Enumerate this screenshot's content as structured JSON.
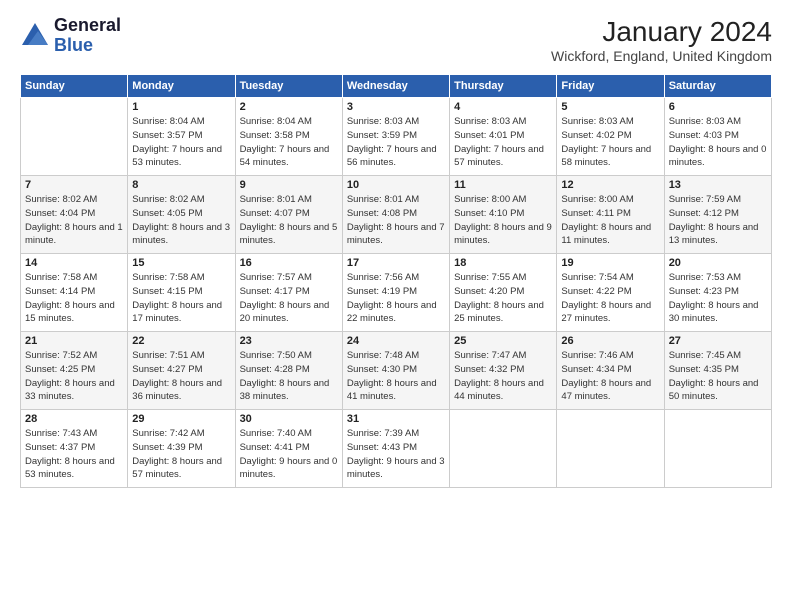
{
  "header": {
    "logo_line1": "General",
    "logo_line2": "Blue",
    "month": "January 2024",
    "location": "Wickford, England, United Kingdom"
  },
  "weekdays": [
    "Sunday",
    "Monday",
    "Tuesday",
    "Wednesday",
    "Thursday",
    "Friday",
    "Saturday"
  ],
  "weeks": [
    [
      {
        "day": "",
        "sunrise": "",
        "sunset": "",
        "daylight": ""
      },
      {
        "day": "1",
        "sunrise": "Sunrise: 8:04 AM",
        "sunset": "Sunset: 3:57 PM",
        "daylight": "Daylight: 7 hours and 53 minutes."
      },
      {
        "day": "2",
        "sunrise": "Sunrise: 8:04 AM",
        "sunset": "Sunset: 3:58 PM",
        "daylight": "Daylight: 7 hours and 54 minutes."
      },
      {
        "day": "3",
        "sunrise": "Sunrise: 8:03 AM",
        "sunset": "Sunset: 3:59 PM",
        "daylight": "Daylight: 7 hours and 56 minutes."
      },
      {
        "day": "4",
        "sunrise": "Sunrise: 8:03 AM",
        "sunset": "Sunset: 4:01 PM",
        "daylight": "Daylight: 7 hours and 57 minutes."
      },
      {
        "day": "5",
        "sunrise": "Sunrise: 8:03 AM",
        "sunset": "Sunset: 4:02 PM",
        "daylight": "Daylight: 7 hours and 58 minutes."
      },
      {
        "day": "6",
        "sunrise": "Sunrise: 8:03 AM",
        "sunset": "Sunset: 4:03 PM",
        "daylight": "Daylight: 8 hours and 0 minutes."
      }
    ],
    [
      {
        "day": "7",
        "sunrise": "Sunrise: 8:02 AM",
        "sunset": "Sunset: 4:04 PM",
        "daylight": "Daylight: 8 hours and 1 minute."
      },
      {
        "day": "8",
        "sunrise": "Sunrise: 8:02 AM",
        "sunset": "Sunset: 4:05 PM",
        "daylight": "Daylight: 8 hours and 3 minutes."
      },
      {
        "day": "9",
        "sunrise": "Sunrise: 8:01 AM",
        "sunset": "Sunset: 4:07 PM",
        "daylight": "Daylight: 8 hours and 5 minutes."
      },
      {
        "day": "10",
        "sunrise": "Sunrise: 8:01 AM",
        "sunset": "Sunset: 4:08 PM",
        "daylight": "Daylight: 8 hours and 7 minutes."
      },
      {
        "day": "11",
        "sunrise": "Sunrise: 8:00 AM",
        "sunset": "Sunset: 4:10 PM",
        "daylight": "Daylight: 8 hours and 9 minutes."
      },
      {
        "day": "12",
        "sunrise": "Sunrise: 8:00 AM",
        "sunset": "Sunset: 4:11 PM",
        "daylight": "Daylight: 8 hours and 11 minutes."
      },
      {
        "day": "13",
        "sunrise": "Sunrise: 7:59 AM",
        "sunset": "Sunset: 4:12 PM",
        "daylight": "Daylight: 8 hours and 13 minutes."
      }
    ],
    [
      {
        "day": "14",
        "sunrise": "Sunrise: 7:58 AM",
        "sunset": "Sunset: 4:14 PM",
        "daylight": "Daylight: 8 hours and 15 minutes."
      },
      {
        "day": "15",
        "sunrise": "Sunrise: 7:58 AM",
        "sunset": "Sunset: 4:15 PM",
        "daylight": "Daylight: 8 hours and 17 minutes."
      },
      {
        "day": "16",
        "sunrise": "Sunrise: 7:57 AM",
        "sunset": "Sunset: 4:17 PM",
        "daylight": "Daylight: 8 hours and 20 minutes."
      },
      {
        "day": "17",
        "sunrise": "Sunrise: 7:56 AM",
        "sunset": "Sunset: 4:19 PM",
        "daylight": "Daylight: 8 hours and 22 minutes."
      },
      {
        "day": "18",
        "sunrise": "Sunrise: 7:55 AM",
        "sunset": "Sunset: 4:20 PM",
        "daylight": "Daylight: 8 hours and 25 minutes."
      },
      {
        "day": "19",
        "sunrise": "Sunrise: 7:54 AM",
        "sunset": "Sunset: 4:22 PM",
        "daylight": "Daylight: 8 hours and 27 minutes."
      },
      {
        "day": "20",
        "sunrise": "Sunrise: 7:53 AM",
        "sunset": "Sunset: 4:23 PM",
        "daylight": "Daylight: 8 hours and 30 minutes."
      }
    ],
    [
      {
        "day": "21",
        "sunrise": "Sunrise: 7:52 AM",
        "sunset": "Sunset: 4:25 PM",
        "daylight": "Daylight: 8 hours and 33 minutes."
      },
      {
        "day": "22",
        "sunrise": "Sunrise: 7:51 AM",
        "sunset": "Sunset: 4:27 PM",
        "daylight": "Daylight: 8 hours and 36 minutes."
      },
      {
        "day": "23",
        "sunrise": "Sunrise: 7:50 AM",
        "sunset": "Sunset: 4:28 PM",
        "daylight": "Daylight: 8 hours and 38 minutes."
      },
      {
        "day": "24",
        "sunrise": "Sunrise: 7:48 AM",
        "sunset": "Sunset: 4:30 PM",
        "daylight": "Daylight: 8 hours and 41 minutes."
      },
      {
        "day": "25",
        "sunrise": "Sunrise: 7:47 AM",
        "sunset": "Sunset: 4:32 PM",
        "daylight": "Daylight: 8 hours and 44 minutes."
      },
      {
        "day": "26",
        "sunrise": "Sunrise: 7:46 AM",
        "sunset": "Sunset: 4:34 PM",
        "daylight": "Daylight: 8 hours and 47 minutes."
      },
      {
        "day": "27",
        "sunrise": "Sunrise: 7:45 AM",
        "sunset": "Sunset: 4:35 PM",
        "daylight": "Daylight: 8 hours and 50 minutes."
      }
    ],
    [
      {
        "day": "28",
        "sunrise": "Sunrise: 7:43 AM",
        "sunset": "Sunset: 4:37 PM",
        "daylight": "Daylight: 8 hours and 53 minutes."
      },
      {
        "day": "29",
        "sunrise": "Sunrise: 7:42 AM",
        "sunset": "Sunset: 4:39 PM",
        "daylight": "Daylight: 8 hours and 57 minutes."
      },
      {
        "day": "30",
        "sunrise": "Sunrise: 7:40 AM",
        "sunset": "Sunset: 4:41 PM",
        "daylight": "Daylight: 9 hours and 0 minutes."
      },
      {
        "day": "31",
        "sunrise": "Sunrise: 7:39 AM",
        "sunset": "Sunset: 4:43 PM",
        "daylight": "Daylight: 9 hours and 3 minutes."
      },
      {
        "day": "",
        "sunrise": "",
        "sunset": "",
        "daylight": ""
      },
      {
        "day": "",
        "sunrise": "",
        "sunset": "",
        "daylight": ""
      },
      {
        "day": "",
        "sunrise": "",
        "sunset": "",
        "daylight": ""
      }
    ]
  ]
}
